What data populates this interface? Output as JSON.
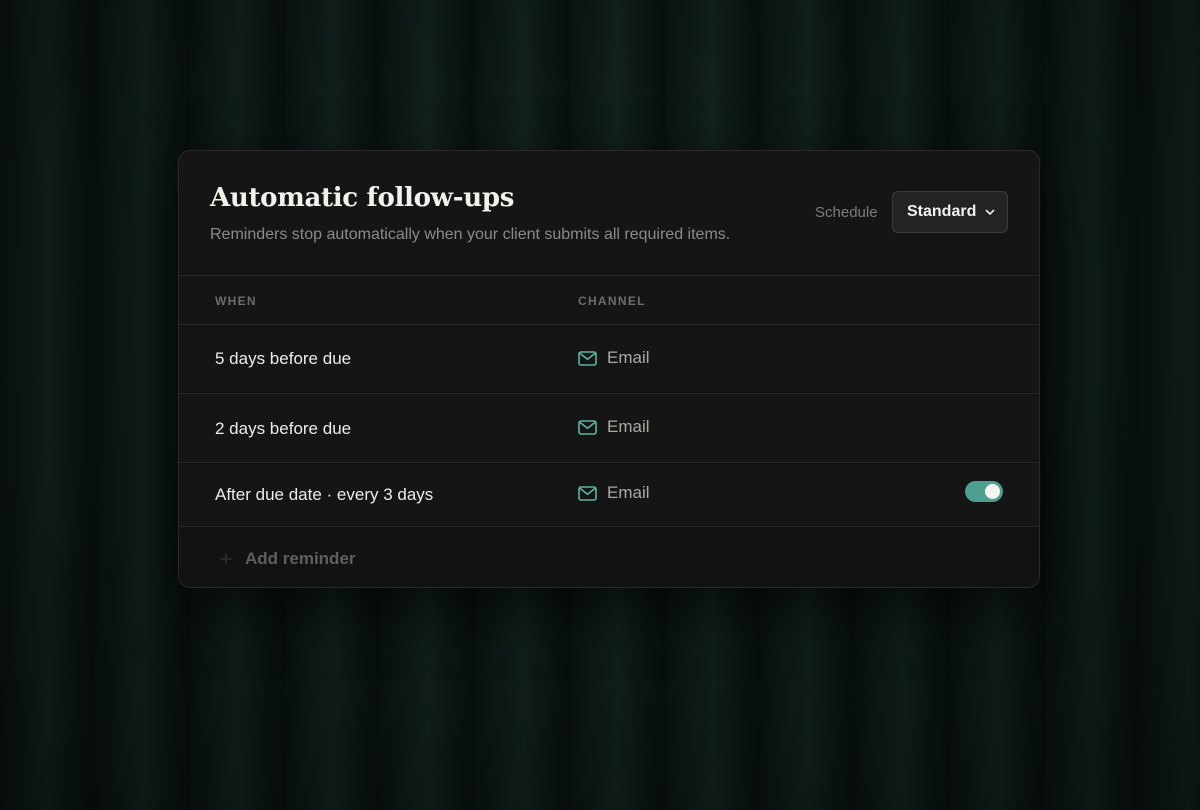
{
  "card": {
    "title": "Automatic follow-ups",
    "subtitle": "Reminders stop automatically when your client submits all required items."
  },
  "schedule": {
    "label": "Schedule",
    "selected": "Standard",
    "icon": "chevron-down-icon"
  },
  "table": {
    "columns": [
      "WHEN",
      "CHANNEL"
    ],
    "rows": [
      {
        "when": "5 days before due",
        "channel": "Email",
        "channel_icon": "mail-icon"
      },
      {
        "when": "2 days before due",
        "channel": "Email",
        "channel_icon": "mail-icon"
      },
      {
        "when": "After due date · every 3 days",
        "channel": "Email",
        "channel_icon": "mail-icon",
        "toggle_on": true
      }
    ]
  },
  "footer": {
    "add_label": "Add reminder",
    "icon": "plus-icon"
  },
  "colors": {
    "accent": "#4f9f90",
    "card_bg": "#151515",
    "page_bg": "#0b1412"
  }
}
